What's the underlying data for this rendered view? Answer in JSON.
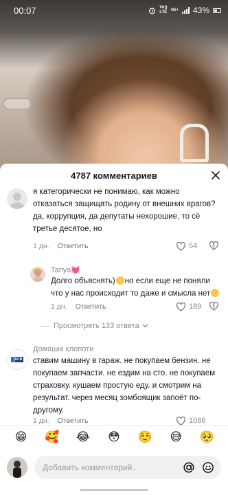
{
  "status_bar": {
    "time": "00:07",
    "network_line1": "Vo))",
    "network_line2": "LTE",
    "network_type": "4G+",
    "battery_percent": "43%"
  },
  "sheet": {
    "title": "4787 комментариев"
  },
  "comments": [
    {
      "text": "я категорически не понимаю, как можно отказаться защищать родину от внешних врагов? да, коррупция, да депутаты нехорошие, то сё третье десятое, но",
      "time": "1 дн.",
      "reply_label": "Ответить",
      "likes": "54"
    },
    {
      "username": "Tanya💓",
      "text_before": "Долго объяснять)",
      "text_middle": "но если еще не поняли что у нас происходит то даже и смысла нет",
      "time": "1 дн.",
      "reply_label": "Ответить",
      "likes": "189"
    },
    {
      "username": "Домашні клопоти",
      "avatar_text": "КСВ",
      "text": "ставим машину в гараж. не покупаем бензин. не покупаем запчасти. не ездим на сто. не покупаем страховку. кушаем простую еду. и смотрим на результат. через месяц зомбоящик запоёт по-другому.",
      "time": "1 дн.",
      "reply_label": "Ответить",
      "likes": "1086"
    }
  ],
  "view_replies_label": "Просмотреть 133 ответа",
  "emoji_bar": [
    "😁",
    "🥰",
    "😂",
    "😳",
    "☺️",
    "😅",
    "🥺"
  ],
  "input": {
    "placeholder": "Добавить комментарий..."
  },
  "colors": {
    "text_primary": "#161823",
    "text_secondary": "#8a8b91",
    "input_bg": "#f1f1f2"
  }
}
